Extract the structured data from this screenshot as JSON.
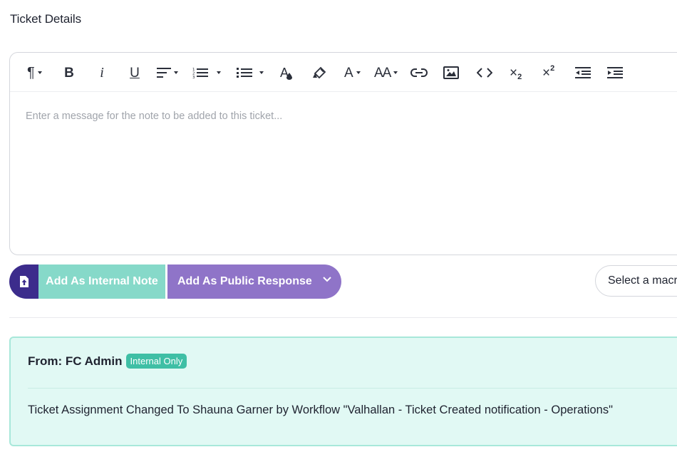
{
  "page": {
    "title": "Ticket Details"
  },
  "editor": {
    "placeholder": "Enter a message for the note to be added to this ticket...",
    "toolbar": {
      "paragraph": "¶",
      "bold": "B",
      "italic": "i",
      "underline": "U",
      "font_color": "A",
      "font_family": "A",
      "font_size": "AA",
      "subscript_digit": "2",
      "superscript_digit": "2"
    }
  },
  "actions": {
    "internal_note_label": "Add As Internal Note",
    "public_response_label": "Add As Public Response",
    "macro_placeholder": "Select a macro"
  },
  "notes": [
    {
      "from": "From: FC Admin",
      "badge": "Internal Only",
      "body": "Ticket Assignment Changed To Shauna Garner by Workflow \"Valhallan - Ticket Created notification - Operations\""
    }
  ],
  "colors": {
    "internal_note": "#86d9c9",
    "public_response": "#8f74c8",
    "icon_button": "#3c2c8c",
    "note_background": "#e1f9f4",
    "badge": "#3fbfa5"
  }
}
